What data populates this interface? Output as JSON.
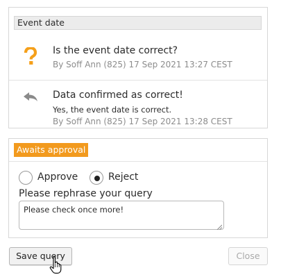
{
  "thread": {
    "section_title": "Event date",
    "question": {
      "icon": "question-mark-icon",
      "title": "Is the event date correct?",
      "meta": "By Soff Ann (825) 17 Sep 2021 13:27 CEST"
    },
    "reply": {
      "icon": "reply-arrow-icon",
      "title": "Data confirmed as correct!",
      "body": "Yes, the event date is correct.",
      "meta": "By Soff Ann (825) 17 Sep 2021 13:28 CEST"
    }
  },
  "approval": {
    "status": "Awaits approval",
    "options": [
      {
        "label": "Approve",
        "selected": false
      },
      {
        "label": "Reject",
        "selected": true
      }
    ],
    "field_label": "Please rephrase your query",
    "field_value": "Please check once more!"
  },
  "actions": {
    "save_label": "Save query",
    "close_label": "Close"
  },
  "colors": {
    "badge": "#f29a1e",
    "question_icon": "#f5a01a",
    "reply_icon": "#8a8a8a"
  }
}
